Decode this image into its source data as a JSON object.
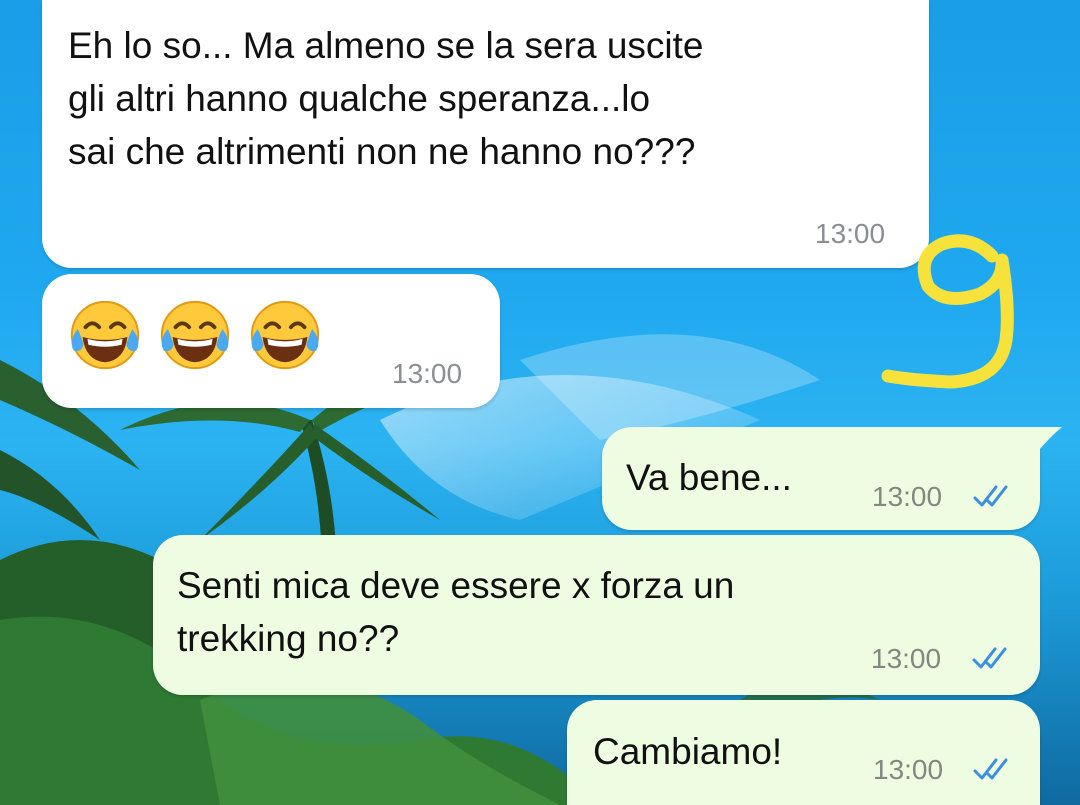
{
  "chat": {
    "messages": [
      {
        "direction": "in",
        "text": "Eh lo so... Ma almeno se la sera uscite\ngli altri hanno qualche speranza...lo\nsai che altrimenti non ne hanno no???",
        "time": "13:00"
      },
      {
        "direction": "in",
        "emoji": [
          "face-with-tears-of-joy",
          "face-with-tears-of-joy",
          "face-with-tears-of-joy"
        ],
        "time": "13:00"
      },
      {
        "direction": "out",
        "text": "Va bene...",
        "time": "13:00",
        "status": "read-double-tick"
      },
      {
        "direction": "out",
        "text": "Senti mica deve essere x forza un\ntrekking no??",
        "time": "13:00",
        "status": "read-double-tick"
      },
      {
        "direction": "out",
        "text": "Cambiamo!",
        "time": "13:00",
        "status": "read-double-tick"
      }
    ]
  },
  "colors": {
    "incoming_bubble": "#ffffff",
    "outgoing_bubble": "#eefde2",
    "read_tick": "#3b8fe0",
    "annotation": "#f6e23a"
  },
  "annotation": {
    "text": "9",
    "color": "yellow",
    "icon": "handwritten-digit"
  }
}
